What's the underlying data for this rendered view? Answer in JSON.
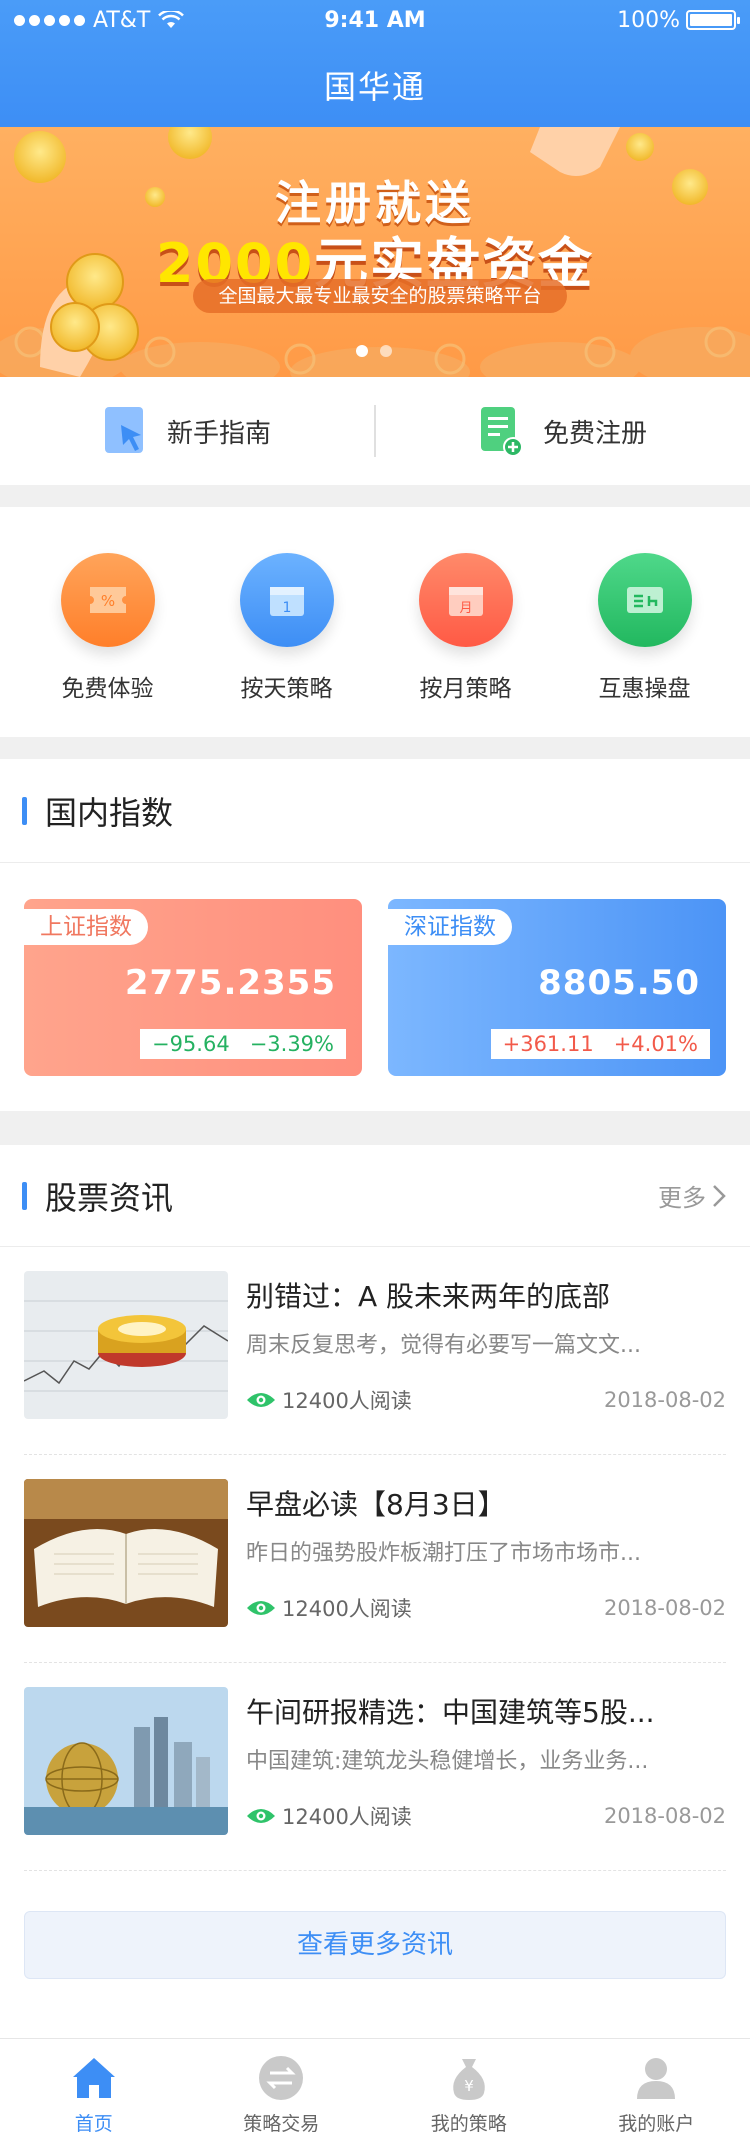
{
  "status": {
    "carrier": "AT&T",
    "time": "9:41 AM",
    "battery": "100%"
  },
  "app": {
    "title": "国华通"
  },
  "banner": {
    "line1": "注册就送",
    "line2_amount": "2000",
    "line2_rest": "元实盘资金",
    "subtitle": "全国最大最专业最安全的股票策略平台",
    "active_index": 0
  },
  "quick_links": [
    {
      "label": "新手指南",
      "icon": "guide-icon"
    },
    {
      "label": "免费注册",
      "icon": "register-icon"
    }
  ],
  "categories": [
    {
      "label": "免费体验",
      "icon": "coupon-icon",
      "color": "#ff8b3d"
    },
    {
      "label": "按天策略",
      "icon": "calendar-day-icon",
      "color": "#4a97f7"
    },
    {
      "label": "按月策略",
      "icon": "calendar-month-icon",
      "color": "#ff6b52"
    },
    {
      "label": "互惠操盘",
      "icon": "exchange-card-icon",
      "color": "#2fc36a"
    }
  ],
  "indices": {
    "section_title": "国内指数",
    "items": [
      {
        "name": "上证指数",
        "value": "2775.2355",
        "change": "−95.64",
        "percent": "−3.39%",
        "color": "#ff9a84"
      },
      {
        "name": "深证指数",
        "value": "8805.50",
        "change": "+361.11",
        "percent": "+4.01%",
        "color": "#5a9ef8"
      }
    ]
  },
  "news": {
    "section_title": "股票资讯",
    "more_label": "更多",
    "items": [
      {
        "title": "别错过：A 股未来两年的底部",
        "desc": "周末反复思考，觉得有必要写一篇文文...",
        "reads": "12400人阅读",
        "date": "2018-08-02",
        "thumb": "stock-chart-chips"
      },
      {
        "title": "早盘必读【8月3日】",
        "desc": "昨日的强势股炸板潮打压了市场市场市...",
        "reads": "12400人阅读",
        "date": "2018-08-02",
        "thumb": "open-book"
      },
      {
        "title": "午间研报精选：中国建筑等5股...",
        "desc": "中国建筑:建筑龙头稳健增长，业务业务...",
        "reads": "12400人阅读",
        "date": "2018-08-02",
        "thumb": "city-skyline"
      }
    ],
    "view_more_label": "查看更多资讯"
  },
  "tabbar": [
    {
      "label": "首页",
      "icon": "home-icon",
      "active": true
    },
    {
      "label": "策略交易",
      "icon": "exchange-icon",
      "active": false
    },
    {
      "label": "我的策略",
      "icon": "money-bag-icon",
      "active": false
    },
    {
      "label": "我的账户",
      "icon": "user-icon",
      "active": false
    }
  ]
}
